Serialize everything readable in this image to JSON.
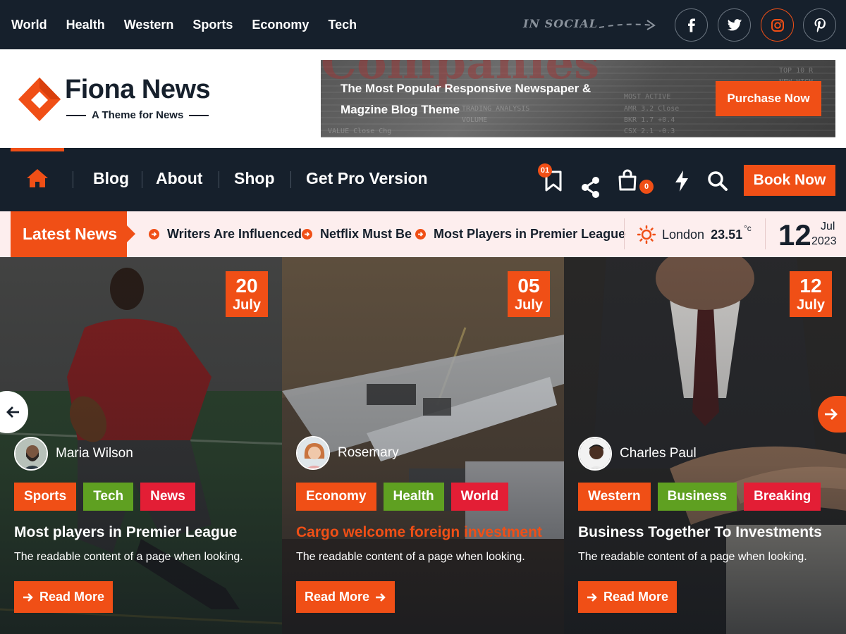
{
  "top_nav": [
    "World",
    "Health",
    "Western",
    "Sports",
    "Economy",
    "Tech"
  ],
  "social": {
    "label": "IN SOCIAL",
    "icons": [
      "facebook-icon",
      "twitter-icon",
      "instagram-icon",
      "pinterest-icon"
    ],
    "active": "instagram-icon"
  },
  "brand": {
    "name": "Fiona News",
    "tagline": "A Theme for News"
  },
  "banner": {
    "text": "The Most Popular Responsive Newspaper & Magzine Blog Theme",
    "button": "Purchase Now"
  },
  "main_nav": {
    "links": [
      "Blog",
      "About",
      "Shop",
      "Get Pro Version"
    ],
    "bookmark_count": "01",
    "cart_count": "0",
    "cta": "Book Now"
  },
  "ticker": {
    "label": "Latest News",
    "items": [
      "Writers Are Influenced",
      "Netflix Must Be",
      "Most Players in Premier League"
    ],
    "weather": {
      "city": "London",
      "temp": "23.51",
      "unit": "°c"
    },
    "date": {
      "day": "12",
      "month": "Jul",
      "year": "2023"
    }
  },
  "cards": [
    {
      "day": "20",
      "month": "July",
      "author": "Maria Wilson",
      "tags": [
        "Sports",
        "Tech",
        "News"
      ],
      "title": "Most players in Premier League",
      "desc": "The readable content of a page when looking.",
      "button": "Read More"
    },
    {
      "day": "05",
      "month": "July",
      "author": "Rosemary",
      "tags": [
        "Economy",
        "Health",
        "World"
      ],
      "title": "Cargo welcome foreign investment",
      "desc": "The readable content of a page when looking.",
      "button": "Read More"
    },
    {
      "day": "12",
      "month": "July",
      "author": "Charles Paul",
      "tags": [
        "Western",
        "Business",
        "Breaking"
      ],
      "title": "Business Together To Investments",
      "desc": "The readable content of a page when looking.",
      "button": "Read More"
    }
  ],
  "colors": {
    "accent": "#f04f16",
    "dark": "#16202c",
    "tag_green": "#5fa021",
    "tag_red": "#e31e35",
    "ticker_bg": "#fdeeee"
  }
}
